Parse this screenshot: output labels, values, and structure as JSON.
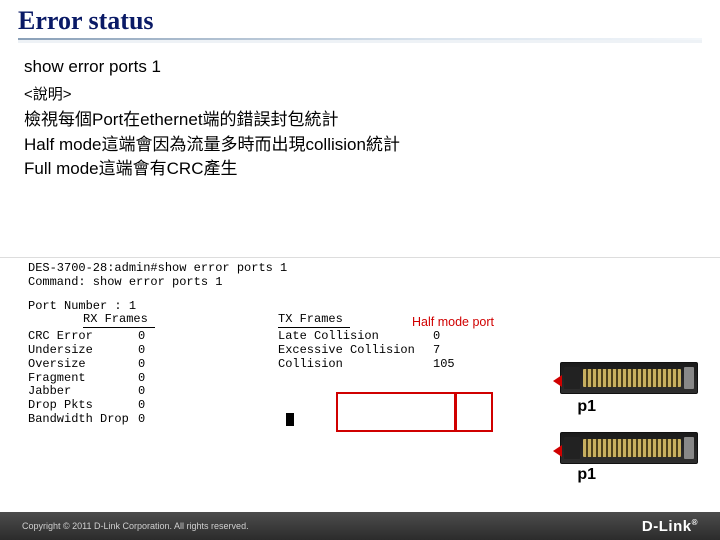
{
  "title": "Error  status",
  "command": "show error ports 1",
  "note_label": "<說明>",
  "desc_line_1": "檢視每個Port在ethernet端的錯誤封包統計",
  "desc_line_2": "Half mode這端會因為流量多時而出現collision統計",
  "desc_line_3": "Full mode這端會有CRC產生",
  "terminal": {
    "prompt_line": "DES-3700-28:admin#show error ports 1",
    "echo_line": "Command: show error ports 1",
    "port_line": "Port Number : 1",
    "rx_header": "RX Frames",
    "tx_header": "TX Frames",
    "left_rows": [
      {
        "label": "CRC Error",
        "value": "0"
      },
      {
        "label": "Undersize",
        "value": "0"
      },
      {
        "label": "Oversize",
        "value": "0"
      },
      {
        "label": "Fragment",
        "value": "0"
      },
      {
        "label": "Jabber",
        "value": "0"
      },
      {
        "label": "Drop Pkts",
        "value": "0"
      },
      {
        "label": "Bandwidth Drop",
        "value": "0"
      }
    ],
    "right_rows": [
      {
        "label": "Late Collision",
        "value": "0"
      },
      {
        "label": "Excessive Collision",
        "value": "7"
      },
      {
        "label": "Collision",
        "value": "105"
      }
    ]
  },
  "half_mode_label": "Half mode port",
  "port_label_1": "p1",
  "port_label_2": "p1",
  "footer": {
    "copyright": "Copyright ©  2011  D-Link Corporation. All rights reserved.",
    "brand": "D-Link",
    "reg": "®"
  }
}
